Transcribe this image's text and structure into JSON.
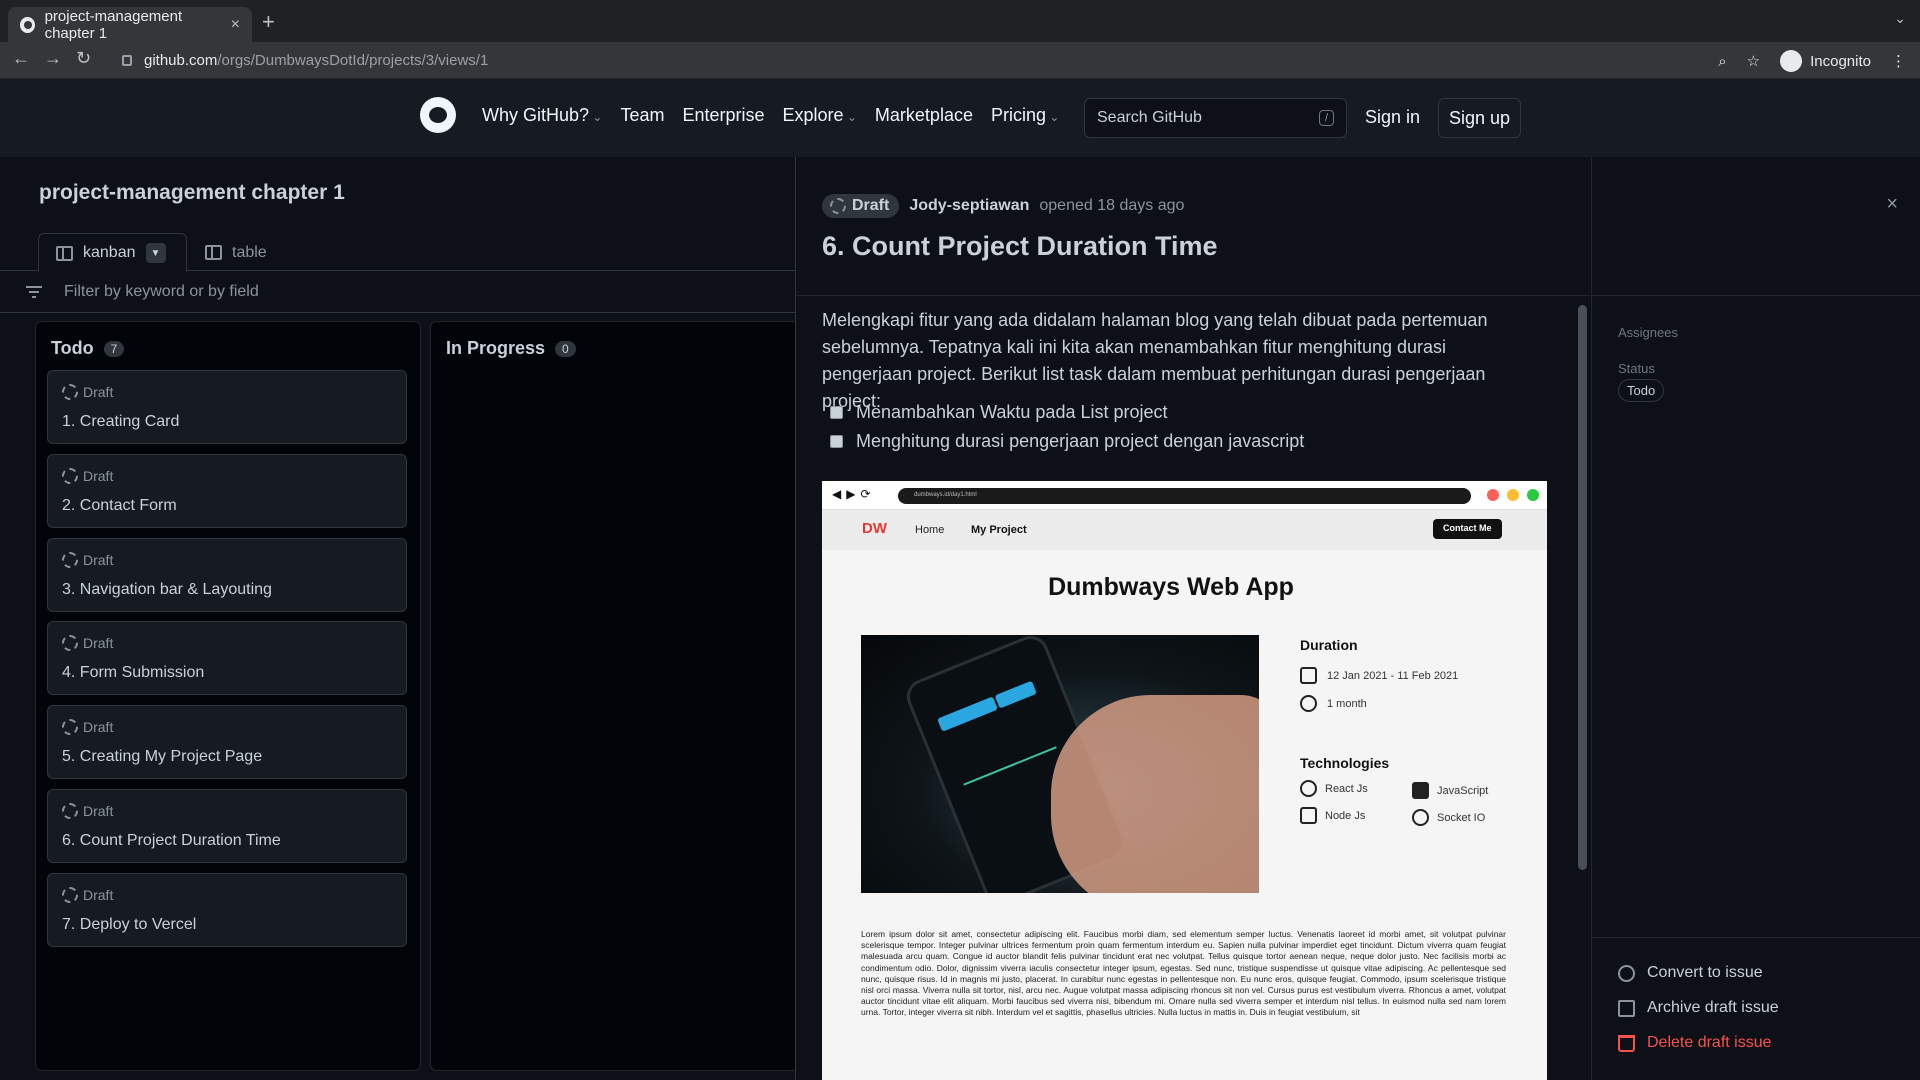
{
  "browser": {
    "tab_title": "project-management chapter 1",
    "tab_close": "×",
    "new_tab": "+",
    "url_host": "github.com",
    "url_path": "/orgs/DumbwaysDotId/projects/3/views/1",
    "profile_label": "Incognito"
  },
  "github_header": {
    "nav": [
      "Why GitHub?",
      "Team",
      "Enterprise",
      "Explore",
      "Marketplace",
      "Pricing"
    ],
    "search_placeholder": "Search GitHub",
    "search_shortcut": "/",
    "sign_in": "Sign in",
    "sign_up": "Sign up"
  },
  "project": {
    "title": "project-management chapter 1",
    "views": [
      {
        "label": "kanban",
        "active": true
      },
      {
        "label": "table",
        "active": false
      }
    ],
    "filter_placeholder": "Filter by keyword or by field",
    "columns": [
      {
        "name": "Todo",
        "count": "7",
        "cards": [
          {
            "status": "Draft",
            "title": "1. Creating Card"
          },
          {
            "status": "Draft",
            "title": "2. Contact Form"
          },
          {
            "status": "Draft",
            "title": "3. Navigation bar & Layouting"
          },
          {
            "status": "Draft",
            "title": "4. Form Submission"
          },
          {
            "status": "Draft",
            "title": "5. Creating My Project Page"
          },
          {
            "status": "Draft",
            "title": "6. Count Project Duration Time"
          },
          {
            "status": "Draft",
            "title": "7. Deploy to Vercel"
          }
        ]
      },
      {
        "name": "In Progress",
        "count": "0",
        "cards": []
      }
    ]
  },
  "issue_panel": {
    "badge": "Draft",
    "author": "Jody-septiawan",
    "opened_text": "opened 18 days ago",
    "title": "6. Count Project Duration Time",
    "description": "Melengkapi fitur yang ada didalam halaman blog yang telah dibuat pada pertemuan sebelumnya. Tepatnya kali ini kita akan menambahkan fitur menghitung durasi pengerjaan project. Berikut list task dalam membuat perhitungan durasi pengerjaan project:",
    "tasks": [
      "Menambahkan Waktu pada List project",
      "Menghitung durasi pengerjaan project dengan javascript"
    ],
    "embedded_screenshot": {
      "url": "dumbways.id/day1.html",
      "logo": "DW",
      "nav_home": "Home",
      "nav_project": "My Project",
      "contact_button": "Contact Me",
      "heading": "Dumbways Web App",
      "duration_heading": "Duration",
      "date_range": "12 Jan 2021 - 11 Feb 2021",
      "duration": "1 month",
      "tech_heading": "Technologies",
      "technologies": [
        "React Js",
        "JavaScript",
        "Node Js",
        "Socket IO"
      ],
      "lorem": "Lorem ipsum dolor sit amet, consectetur adipiscing elit. Faucibus morbi diam, sed elementum semper luctus. Venenatis laoreet id morbi amet, sit volutpat pulvinar scelerisque tempor. Integer pulvinar ultrices fermentum proin quam fermentum interdum eu. Sapien nulla pulvinar imperdiet eget tincidunt. Dictum viverra quam feugiat malesuada arcu quam. Congue id auctor blandit felis pulvinar tincidunt erat nec volutpat. Tellus quisque tortor aenean neque, neque dolor justo. Nec facilisis morbi ac condimentum odio. Dolor, dignissim viverra iaculis consectetur integer ipsum, egestas. Sed nunc, tristique suspendisse ut quisque vitae adipiscing. Ac pellentesque sed nunc, quisque risus. Id in magnis mi justo, placerat. In curabitur nunc egestas in pellentesque non. Eu nunc eros, quisque feugiat. Commodo, ipsum scelerisque tristique nisl orci massa. Viverra nulla sit tortor, nisl, arcu nec. Augue volutpat massa adipiscing rhoncus sit non vel. Cursus purus est vestibulum viverra. Rhoncus a amet, volutpat auctor tincidunt vitae elit aliquam. Morbi faucibus sed viverra nisi, bibendum mi. Ornare nulla sed viverra semper et interdum nisl tellus. In euismod nulla sed nam lorem urna. Tortor, integer viverra sit nibh. Interdum vel et sagittis, phasellus ultricies. Nulla luctus in mattis in. Duis in feugiat vestibulum, sit"
    },
    "sidebar": {
      "assignees_label": "Assignees",
      "status_label": "Status",
      "status_value": "Todo",
      "actions": [
        "Convert to issue",
        "Archive draft issue",
        "Delete draft issue"
      ]
    },
    "close": "×"
  },
  "colors": {
    "danger": "#f85149",
    "accent_blue": "#2aa7e0",
    "logo_red": "#e53935"
  },
  "icons": [
    "github-favicon",
    "back-arrow-icon",
    "forward-arrow-icon",
    "reload-icon",
    "lock-icon",
    "zoom-icon",
    "star-icon",
    "incognito-icon",
    "menu-dots-icon",
    "github-logo-icon",
    "board-icon",
    "table-icon",
    "filter-icon",
    "draft-icon",
    "close-icon",
    "calendar-icon",
    "clock-icon",
    "react-icon",
    "javascript-icon",
    "nodejs-icon",
    "socketio-icon",
    "convert-icon",
    "archive-icon",
    "trash-icon"
  ]
}
